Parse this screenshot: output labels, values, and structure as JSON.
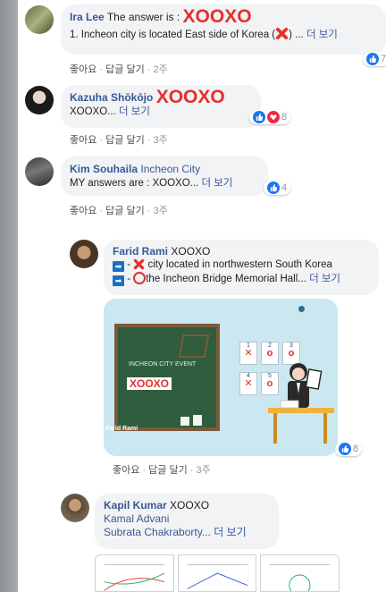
{
  "comments": [
    {
      "name": "Ira Lee",
      "head_text": "The answer is :",
      "xo": "XOOXO",
      "line2_pre": "1. Incheon city is located East side of Korea (",
      "line2_post": ") ...",
      "more": "더 보기",
      "actions": {
        "like": "좋아요",
        "reply": "답글 달기",
        "time": "2주"
      },
      "reaction_count": "7"
    },
    {
      "name": "Kazuha Shōkōjo",
      "xo": "XOOXO",
      "line2": "XOOXO...",
      "more": "더 보기",
      "actions": {
        "like": "좋아요",
        "reply": "답글 달기",
        "time": "3주"
      },
      "reaction_count": "8"
    },
    {
      "name": "Kim Souhaila",
      "tag": "Incheon City",
      "line2": "MY answers are : XOOXO...",
      "more": "더 보기",
      "actions": {
        "like": "좋아요",
        "reply": "답글 달기",
        "time": "3주"
      },
      "reaction_count": "4"
    },
    {
      "name": "Farid Rami",
      "head_text": "XOOXO",
      "line2_post": "city located in northwestern South Korea",
      "line3_post": "the Incheon Bridge Memorial Hall...",
      "more": "더 보기",
      "actions": {
        "like": "좋아요",
        "reply": "답글 달기",
        "time": "3주"
      },
      "reaction_count": "8",
      "image": {
        "board_title": "INCHEON CITY EVENT",
        "board_answer": "XOOXO",
        "signature": "Farid Rami",
        "cards": [
          "1",
          "2",
          "3",
          "4",
          "5"
        ]
      }
    },
    {
      "name": "Kapil Kumar",
      "head_text": "XOOXO",
      "line2": "Kamal Advani",
      "line3": "Subrata Chakraborty...",
      "more": "더 보기"
    }
  ],
  "colors": {
    "link": "#385898",
    "accent_red": "#e5302b",
    "like_blue": "#1877f2",
    "love_red": "#f02849"
  }
}
